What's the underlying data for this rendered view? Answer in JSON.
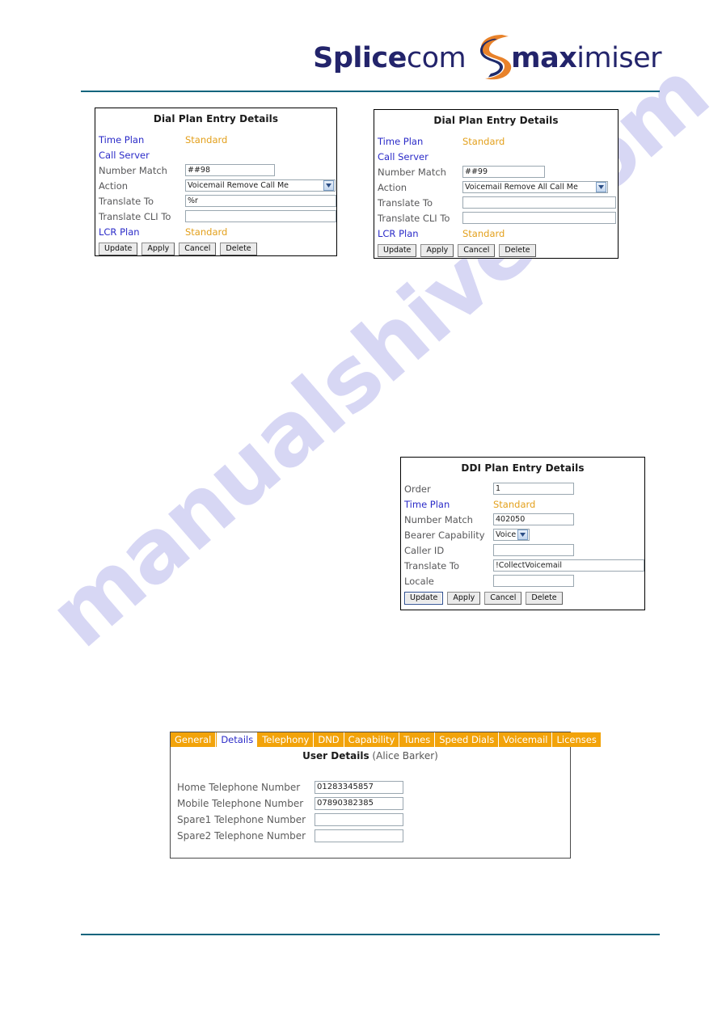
{
  "header": {
    "logo": {
      "brand_prefix_bold": "Splice",
      "brand_prefix_light": "com",
      "swoosh_icon": "s-swoosh-icon",
      "product_bold": "max",
      "product_light": "imiser",
      "text_color": "#23246b",
      "swoosh_color": "#e8822a"
    },
    "rule_color": "#10647d"
  },
  "watermark": {
    "text": "manualshive.com",
    "color": "#c9c9f0"
  },
  "panels": {
    "dial_plan_1": {
      "title": "Dial Plan Entry Details",
      "rows": [
        {
          "label": "Time Plan",
          "kind": "link-static",
          "value": "Standard"
        },
        {
          "label": "Call Server",
          "kind": "link-static",
          "value": ""
        },
        {
          "label": "Number Match",
          "kind": "text",
          "value": "##98"
        },
        {
          "label": "Action",
          "kind": "select",
          "value": "Voicemail Remove Call Me"
        },
        {
          "label": "Translate To",
          "kind": "text-wide",
          "value": "%r"
        },
        {
          "label": "Translate CLI To",
          "kind": "text-wide",
          "value": ""
        },
        {
          "label": "LCR Plan",
          "kind": "link-static",
          "value": "Standard"
        }
      ],
      "buttons": [
        {
          "label": "Update",
          "focused": false
        },
        {
          "label": "Apply",
          "focused": false
        },
        {
          "label": "Cancel",
          "focused": false
        },
        {
          "label": "Delete",
          "focused": false
        }
      ]
    },
    "dial_plan_2": {
      "title": "Dial Plan Entry Details",
      "rows": [
        {
          "label": "Time Plan",
          "kind": "link-static",
          "value": "Standard"
        },
        {
          "label": "Call Server",
          "kind": "link-static",
          "value": ""
        },
        {
          "label": "Number Match",
          "kind": "text",
          "value": "##99"
        },
        {
          "label": "Action",
          "kind": "select",
          "value": "Voicemail Remove All Call Me"
        },
        {
          "label": "Translate To",
          "kind": "text-wide",
          "value": ""
        },
        {
          "label": "Translate CLI To",
          "kind": "text-wide",
          "value": ""
        },
        {
          "label": "LCR Plan",
          "kind": "link-static",
          "value": "Standard"
        }
      ],
      "buttons": [
        {
          "label": "Update",
          "focused": false
        },
        {
          "label": "Apply",
          "focused": false
        },
        {
          "label": "Cancel",
          "focused": false
        },
        {
          "label": "Delete",
          "focused": false
        }
      ]
    },
    "ddi_plan": {
      "title": "DDI Plan Entry Details",
      "rows": [
        {
          "label": "Order",
          "kind": "text",
          "value": "1"
        },
        {
          "label": "Time Plan",
          "kind": "link-static",
          "value": "Standard"
        },
        {
          "label": "Number Match",
          "kind": "text",
          "value": "402050"
        },
        {
          "label": "Bearer Capability",
          "kind": "select-sm",
          "value": "Voice"
        },
        {
          "label": "Caller ID",
          "kind": "text",
          "value": ""
        },
        {
          "label": "Translate To",
          "kind": "text-wide",
          "value": "!CollectVoicemail"
        },
        {
          "label": "Locale",
          "kind": "text",
          "value": ""
        }
      ],
      "buttons": [
        {
          "label": "Update",
          "focused": true
        },
        {
          "label": "Apply",
          "focused": false
        },
        {
          "label": "Cancel",
          "focused": false
        },
        {
          "label": "Delete",
          "focused": false
        }
      ]
    },
    "user_details": {
      "tabs": [
        {
          "label": "General",
          "active": false
        },
        {
          "label": "Details",
          "active": true
        },
        {
          "label": "Telephony",
          "active": false
        },
        {
          "label": "DND",
          "active": false
        },
        {
          "label": "Capability",
          "active": false
        },
        {
          "label": "Tunes",
          "active": false
        },
        {
          "label": "Speed Dials",
          "active": false
        },
        {
          "label": "Voicemail",
          "active": false
        },
        {
          "label": "Licenses",
          "active": false
        }
      ],
      "heading_bold": "User Details",
      "heading_name": "(Alice Barker)",
      "fields": [
        {
          "label": "Home Telephone Number",
          "value": "01283345857"
        },
        {
          "label": "Mobile Telephone Number",
          "value": "07890382385"
        },
        {
          "label": "Spare1 Telephone Number",
          "value": ""
        },
        {
          "label": "Spare2 Telephone Number",
          "value": ""
        }
      ],
      "tab_color": "#f2a30a",
      "active_tab_text_color": "#2b2bc8"
    }
  }
}
